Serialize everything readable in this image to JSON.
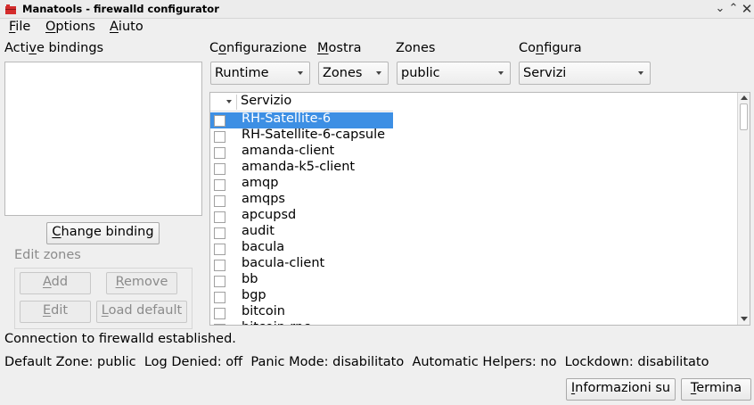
{
  "window": {
    "title": "Manatools - firewalld configurator",
    "controls": [
      "chevron-down-icon",
      "chevron-up-icon",
      "close-icon"
    ]
  },
  "menu": {
    "file": {
      "pre": "",
      "key": "F",
      "post": "ile"
    },
    "options": {
      "pre": "",
      "key": "O",
      "post": "ptions"
    },
    "aiuto": {
      "pre": "",
      "key": "A",
      "post": "iuto"
    }
  },
  "left_panel": {
    "active_bindings": {
      "pre": "Acti",
      "key": "v",
      "post": "e bindings"
    },
    "change_binding": {
      "pre": "",
      "key": "C",
      "post": "hange binding"
    },
    "edit_zones": "Edit zones",
    "add": {
      "pre": "",
      "key": "A",
      "post": "dd"
    },
    "remove": {
      "pre": "",
      "key": "R",
      "post": "emove"
    },
    "edit": {
      "pre": "",
      "key": "E",
      "post": "dit"
    },
    "load_default": {
      "pre": "",
      "key": "L",
      "post": "oad default"
    }
  },
  "filters": {
    "configurazione": {
      "pre": "C",
      "key": "o",
      "post": "nfigurazione",
      "value": "Runtime"
    },
    "mostra": {
      "pre": "",
      "key": "M",
      "post": "ostra",
      "value": "Zones"
    },
    "zones": {
      "label": "Zones",
      "value": "public"
    },
    "configura": {
      "pre": "Co",
      "key": "n",
      "post": "figura",
      "value": "Servizi"
    }
  },
  "services_table": {
    "column": "Servizio",
    "selected_index": 0,
    "rows": [
      "RH-Satellite-6",
      "RH-Satellite-6-capsule",
      "amanda-client",
      "amanda-k5-client",
      "amqp",
      "amqps",
      "apcupsd",
      "audit",
      "bacula",
      "bacula-client",
      "bb",
      "bgp",
      "bitcoin",
      "bitcoin-rpc"
    ]
  },
  "status": {
    "connection": "Connection to firewalld established.",
    "details": "Default Zone: public  Log Denied: off  Panic Mode: disabilitato  Automatic Helpers: no  Lockdown: disabilitato"
  },
  "footer": {
    "info": {
      "pre": "",
      "key": "I",
      "post": "nformazioni su"
    },
    "quit": {
      "pre": "",
      "key": "T",
      "post": "ermina"
    }
  },
  "colors": {
    "selection": "#3d8fe4",
    "app_icon": "#d42c2c"
  }
}
